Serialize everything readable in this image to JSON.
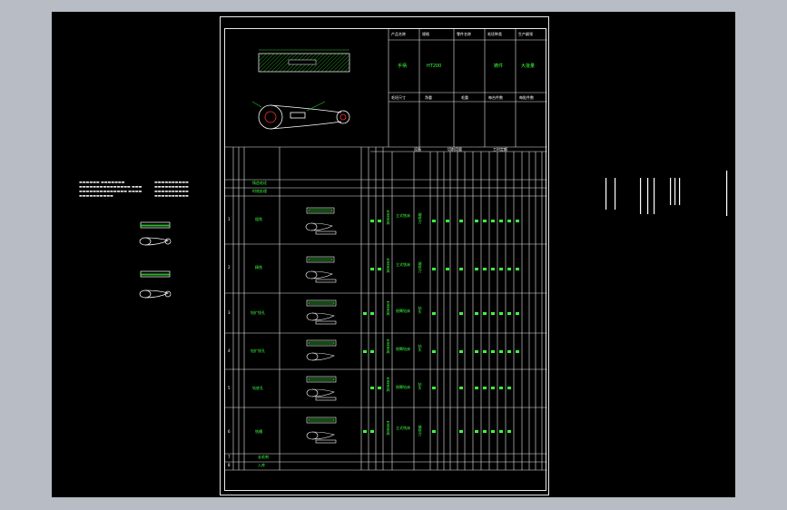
{
  "colors": {
    "background": "#b8bcc4",
    "canvas": "#000000",
    "line": "#e8e8e8",
    "accent": "#3cff3c",
    "shape": "#ffffff",
    "hatch": "#3cff3c",
    "bore": "#ff3030"
  },
  "title_block": {
    "headers": [
      "产品名称",
      "规格",
      "零件名称",
      "毛坯种类",
      "生产纲领"
    ],
    "values": [
      "手柄",
      "HT200",
      "",
      "铸件",
      "大批量"
    ],
    "bottom": [
      "毛坯尺寸",
      "净重",
      "毛重",
      "每台件数",
      "每批件数"
    ]
  },
  "process_table": {
    "group_labels": [
      "设备",
      "切削用量",
      "工时定额"
    ],
    "rows": [
      {
        "no": "",
        "name": "铸造毛坯"
      },
      {
        "no": "",
        "name": "时效处理"
      },
      {
        "no": "1",
        "name": "粗铣",
        "fixture": "专用夹具",
        "machine": "立式铣床",
        "tool": "端铣刀"
      },
      {
        "no": "2",
        "name": "精铣",
        "fixture": "专用夹具",
        "machine": "立式铣床",
        "tool": "端铣刀"
      },
      {
        "no": "3",
        "name": "钻扩铰孔",
        "fixture": "专用夹具",
        "machine": "摇臂钻床",
        "tool": "钻头"
      },
      {
        "no": "4",
        "name": "钻扩铰孔",
        "fixture": "专用夹具",
        "machine": "摇臂钻床",
        "tool": "钻头"
      },
      {
        "no": "5",
        "name": "钻底孔",
        "fixture": "专用夹具",
        "machine": "摇臂钻床",
        "tool": "钻头"
      },
      {
        "no": "6",
        "name": "铣槽",
        "fixture": "专用夹具",
        "machine": "立式铣床",
        "tool": "端铣刀"
      },
      {
        "no": "7",
        "name": "去毛刺"
      },
      {
        "no": "8",
        "name": "入库"
      }
    ]
  }
}
